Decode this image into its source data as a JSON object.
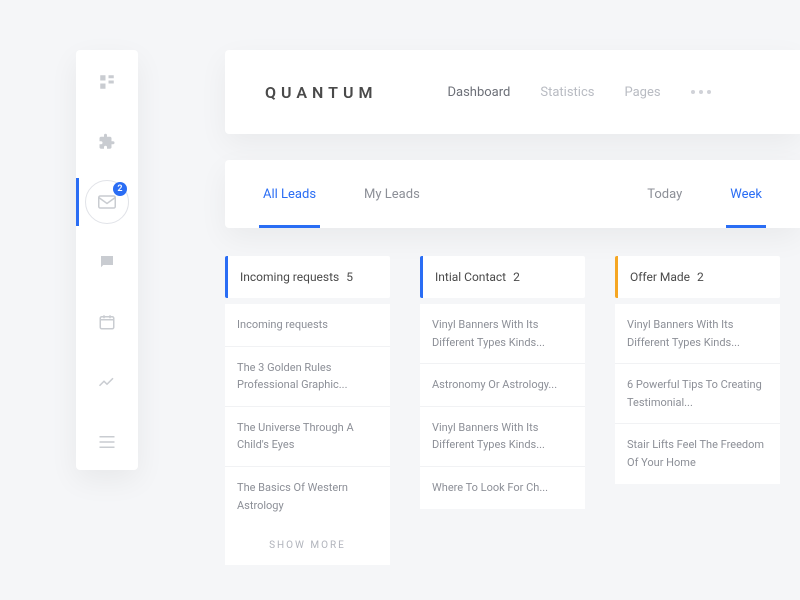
{
  "brand": "QUANTUM",
  "nav": {
    "items": [
      "Dashboard",
      "Statistics",
      "Pages"
    ],
    "current": 0
  },
  "sidebar": {
    "icons": [
      "grid-icon",
      "puzzle-icon",
      "mail-icon",
      "chat-icon",
      "calendar-icon",
      "trend-icon",
      "menu-icon"
    ],
    "active": 2,
    "badge": "2"
  },
  "filter": {
    "left": [
      "All Leads",
      "My Leads"
    ],
    "left_selected": 0,
    "right": [
      "Today",
      "Week"
    ],
    "right_selected": 1
  },
  "columns": [
    {
      "title": "Incoming requests",
      "count": "5",
      "accent": "blue",
      "cards": [
        "Incoming requests",
        "The 3 Golden Rules Professional Graphic...",
        "The Universe Through A Child's Eyes",
        "The Basics Of Western Astrology"
      ],
      "show_more": "SHOW MORE"
    },
    {
      "title": "Intial Contact",
      "count": "2",
      "accent": "blue2",
      "cards": [
        "Vinyl Banners With Its Different Types Kinds...",
        "Astronomy Or Astrology...",
        "Vinyl Banners With Its Different Types Kinds...",
        "Where To Look For Ch..."
      ]
    },
    {
      "title": "Offer Made",
      "count": "2",
      "accent": "orange",
      "cards": [
        "Vinyl Banners With Its Different Types Kinds...",
        "6 Powerful Tips To Creating Testimonial...",
        "Stair Lifts Feel The Freedom Of Your Home"
      ]
    }
  ]
}
